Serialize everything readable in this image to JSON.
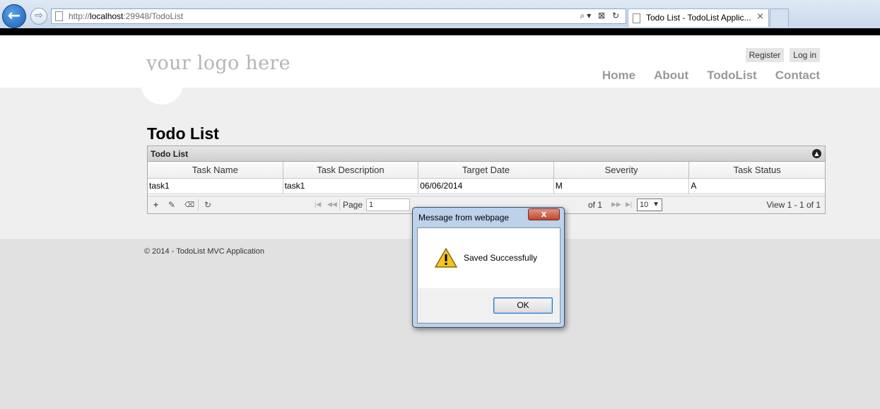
{
  "browser": {
    "url_prefix": "http://",
    "url_host": "localhost",
    "url_rest": ":29948/TodoList",
    "tab_title": "Todo List - TodoList Applic...",
    "tab_close": "×",
    "address_tools": "⌕▾ ⊠ ↻",
    "back_icon": "←",
    "forward_icon": "⇨"
  },
  "site": {
    "logo": "your logo here",
    "login_links": [
      "Register",
      "Log in"
    ],
    "nav": [
      "Home",
      "About",
      "TodoList",
      "Contact"
    ],
    "page_title": "Todo List",
    "footer": "© 2014 - TodoList MVC Application"
  },
  "grid": {
    "caption": "Todo List",
    "columns": [
      "Task Name",
      "Task Description",
      "Target Date",
      "Severity",
      "Task Status"
    ],
    "rows": [
      [
        "task1",
        "task1",
        "06/06/2014",
        "M",
        "A"
      ]
    ],
    "pager": {
      "tools": [
        "+",
        "✎",
        "🗑",
        "↻"
      ],
      "page_label": "Page",
      "page_value": "1",
      "of_label": "of 1",
      "page_size": "10",
      "view_text": "View 1 - 1 of 1"
    }
  },
  "dialog": {
    "title": "Message from webpage",
    "close": "x",
    "message": "Saved Successfully",
    "ok_label": "OK"
  },
  "colors": {
    "accent": "#1d5fb5",
    "content_bg": "#efefef",
    "footer_bg": "#e1e1e1",
    "dialog_frame": "#bcd1ea"
  }
}
